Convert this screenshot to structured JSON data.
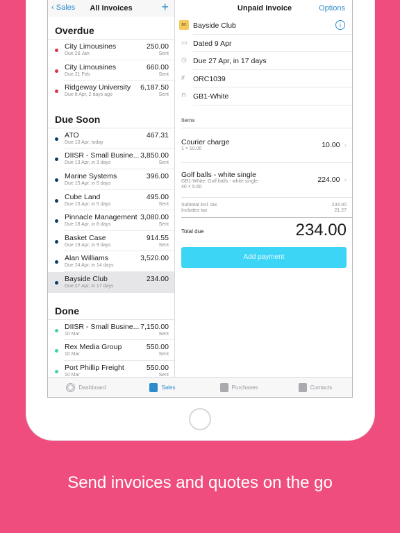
{
  "left": {
    "back": "Sales",
    "title": "All Invoices",
    "add": "+",
    "sections": [
      {
        "title": "Overdue",
        "dot": "#E0323F",
        "rows": [
          {
            "name": "City Limousines",
            "sub": "Due 26 Jan",
            "amount": "250.00",
            "status": "Sent"
          },
          {
            "name": "City Limousines",
            "sub": "Due 21 Feb",
            "amount": "660.00",
            "status": "Sent"
          },
          {
            "name": "Ridgeway University",
            "sub": "Due 8 Apr, 2 days ago",
            "amount": "6,187.50",
            "status": "Sent"
          }
        ]
      },
      {
        "title": "Due Soon",
        "dot": "#0E3C61",
        "rows": [
          {
            "name": "ATO",
            "sub": "Due 10 Apr, today",
            "amount": "467.31",
            "status": ""
          },
          {
            "name": "DIISR - Small Busine...",
            "sub": "Due 13 Apr, in 3 days",
            "amount": "3,850.00",
            "status": "Sent"
          },
          {
            "name": "Marine Systems",
            "sub": "Due 15 Apr, in 5 days",
            "amount": "396.00",
            "status": ""
          },
          {
            "name": "Cube Land",
            "sub": "Due 15 Apr, in 5 days",
            "amount": "495.00",
            "status": "Sent"
          },
          {
            "name": "Pinnacle Management",
            "sub": "Due 18 Apr, in 8 days",
            "amount": "3,080.00",
            "status": "Sent"
          },
          {
            "name": "Basket Case",
            "sub": "Due 19 Apr, in 9 days",
            "amount": "914.55",
            "status": "Sent"
          },
          {
            "name": "Alan Williams",
            "sub": "Due 24 Apr, in 14 days",
            "amount": "3,520.00",
            "status": ""
          },
          {
            "name": "Bayside Club",
            "sub": "Due 27 Apr, in 17 days",
            "amount": "234.00",
            "status": "",
            "selected": true
          }
        ]
      },
      {
        "title": "Done",
        "dot": "#3DD69B",
        "rows": [
          {
            "name": "DIISR - Small Busine...",
            "sub": "10 Mar",
            "amount": "7,150.00",
            "status": "Sent"
          },
          {
            "name": "Rex Media Group",
            "sub": "10 Mar",
            "amount": "550.00",
            "status": "Sent"
          },
          {
            "name": "Port Phillip Freight",
            "sub": "10 Mar",
            "amount": "550.00",
            "status": "Sent"
          }
        ]
      }
    ]
  },
  "right": {
    "title": "Unpaid Invoice",
    "options": "Options",
    "contact_initials": "BC",
    "contact": "Bayside Club",
    "dated": "Dated 9 Apr",
    "due": "Due 27 Apr, in 17 days",
    "number": "ORC1039",
    "reference": "GB1-White",
    "items_label": "Items",
    "items": [
      {
        "name": "Courier charge",
        "sub": "1 × 10.00",
        "sub2": "",
        "value": "10.00"
      },
      {
        "name": "Golf balls - white single",
        "sub": "GB1-White: Golf balls - white single",
        "sub2": "40 × 5.60",
        "value": "224.00"
      }
    ],
    "subtotal_label": "Subtotal incl. tax",
    "subtotal": "234.00",
    "tax_label": "Includes tax",
    "tax": "21.27",
    "total_label": "Total due",
    "total": "234.00",
    "add_payment": "Add payment"
  },
  "tabs": [
    {
      "label": "Dashboard",
      "icon": "dashboard-icon"
    },
    {
      "label": "Sales",
      "icon": "document-icon",
      "active": true
    },
    {
      "label": "Purchases",
      "icon": "receipt-icon"
    },
    {
      "label": "Contacts",
      "icon": "contacts-icon"
    }
  ],
  "caption": "Send invoices and quotes on the go"
}
